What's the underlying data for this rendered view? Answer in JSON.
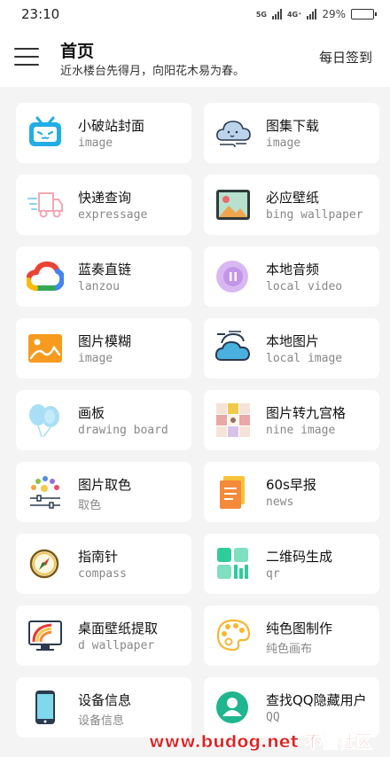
{
  "status_bar": {
    "time": "23:10",
    "network_5g": "5G",
    "network_4g": "4G⁺",
    "battery_text": "29%",
    "battery_level": 0.29
  },
  "header": {
    "title": "首页",
    "subtitle": "近水楼台先得月，向阳花木易为春。",
    "signin_label": "每日签到"
  },
  "tools": [
    {
      "name": "小破站封面",
      "en": "image",
      "icon": "bilibili-tv-icon"
    },
    {
      "name": "图集下载",
      "en": "image",
      "icon": "cloud-wind-icon"
    },
    {
      "name": "快递查询",
      "en": "expressage",
      "icon": "delivery-truck-icon"
    },
    {
      "name": "必应壁纸",
      "en": "bing wallpaper",
      "icon": "landscape-picture-icon"
    },
    {
      "name": "蓝奏直链",
      "en": "lanzou",
      "icon": "google-cloud-icon"
    },
    {
      "name": "本地音频",
      "en": "local video",
      "icon": "audio-pause-icon"
    },
    {
      "name": "图片模糊",
      "en": "image",
      "icon": "orange-picture-icon"
    },
    {
      "name": "本地图片",
      "en": "local image",
      "icon": "sun-cloud-icon"
    },
    {
      "name": "画板",
      "en": "drawing board",
      "icon": "balloons-icon"
    },
    {
      "name": "图片转九宫格",
      "en": "nine image",
      "icon": "nine-grid-icon"
    },
    {
      "name": "图片取色",
      "en": "取色",
      "icon": "palette-sliders-icon"
    },
    {
      "name": "60s早报",
      "en": "news",
      "icon": "newspaper-icon"
    },
    {
      "name": "指南针",
      "en": "compass",
      "icon": "compass-icon"
    },
    {
      "name": "二维码生成",
      "en": "qr",
      "icon": "qr-grid-icon"
    },
    {
      "name": "桌面壁纸提取",
      "en": "d wallpaper",
      "icon": "monitor-rainbow-icon"
    },
    {
      "name": "纯色图制作",
      "en": "纯色画布",
      "icon": "paint-palette-icon"
    },
    {
      "name": "设备信息",
      "en": "设备信息",
      "icon": "phone-icon"
    },
    {
      "name": "查找QQ隐藏用户",
      "en": "QQ",
      "icon": "user-circle-icon"
    }
  ],
  "watermark": "www.budog.net 不懂社区"
}
